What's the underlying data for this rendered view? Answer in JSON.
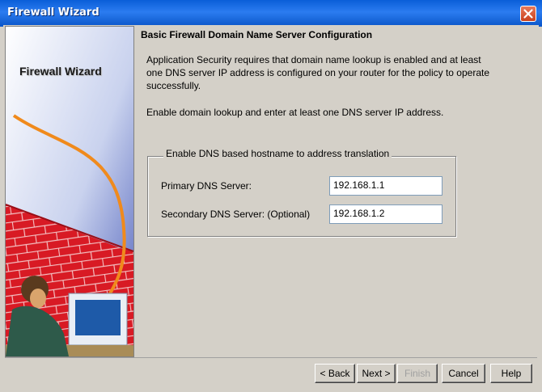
{
  "window": {
    "title": "Firewall Wizard"
  },
  "banner": {
    "title": "Firewall Wizard"
  },
  "main": {
    "heading": "Basic Firewall Domain Name Server Configuration",
    "description_lines": [
      "Application Security requires that domain name lookup is enabled and at least",
      "one DNS server IP address is configured on your router for the policy to operate",
      "successfully."
    ],
    "instruction": "Enable domain lookup and enter at least one DNS server IP address.",
    "group": {
      "legend": "Enable DNS based hostname to address translation",
      "primary_label": "Primary DNS Server:",
      "primary_value": "192.168.1.1",
      "secondary_label": "Secondary DNS Server: (Optional)",
      "secondary_value": "192.168.1.2"
    }
  },
  "buttons": {
    "back": "< Back",
    "next": "Next >",
    "finish": "Finish",
    "cancel": "Cancel",
    "help": "Help"
  },
  "icons": {
    "close": "close-icon",
    "illustration": "firewall-illustration"
  },
  "colors": {
    "titlebar": "#0a5ed8",
    "dialog": "#d4d0c8",
    "close": "#c9401c"
  }
}
